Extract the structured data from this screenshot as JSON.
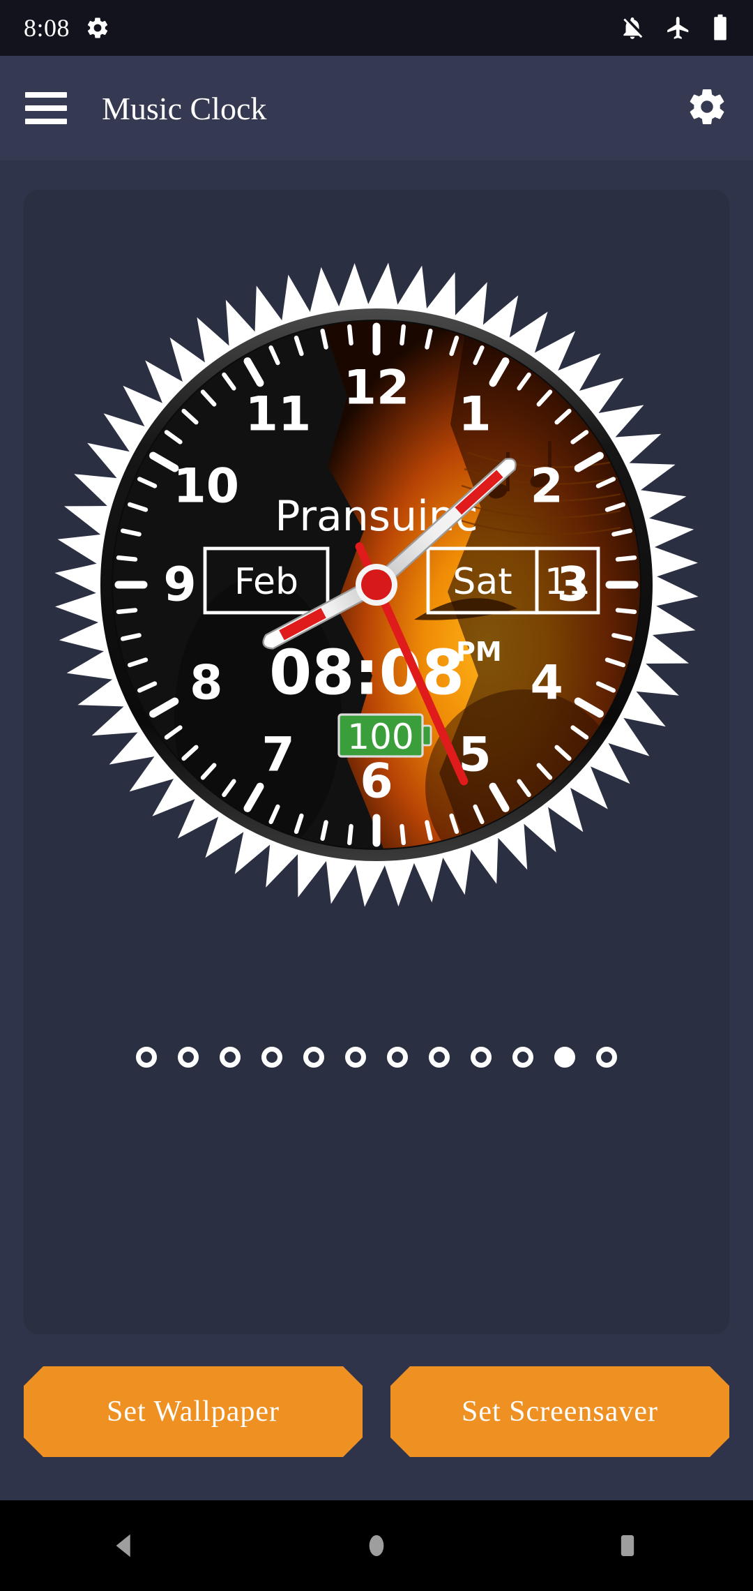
{
  "status_bar": {
    "time": "8:08",
    "icons": [
      "settings-gear-icon",
      "notifications-off-icon",
      "airplane-mode-icon",
      "battery-full-icon"
    ]
  },
  "app_bar": {
    "menu_icon": "hamburger-menu-icon",
    "title": "Music Clock",
    "settings_icon": "gear-icon"
  },
  "clock": {
    "brand": "Pransuinc",
    "month": "Feb",
    "weekday": "Sat",
    "day": "11",
    "digital_time": "08:08",
    "meridiem": "PM",
    "battery": "100",
    "hour_numerals": [
      "1",
      "2",
      "3",
      "4",
      "5",
      "6",
      "7",
      "8",
      "9",
      "10",
      "11",
      "12"
    ],
    "hands": {
      "hour_deg": 242,
      "minute_deg": 48,
      "second_deg": 156
    },
    "colors": {
      "second_hand": "#e01b1b",
      "hand_white": "#f2f2f2",
      "hub": "#d81919",
      "battery_badge": "#3a9e3a",
      "dial_dark": "#121212",
      "dial_flame": "#e08a10"
    }
  },
  "pager": {
    "total": 12,
    "active_index": 10
  },
  "buttons": {
    "set_wallpaper": "Set Wallpaper",
    "set_screensaver": "Set Screensaver",
    "accent_color": "#ef9022"
  },
  "nav_bar": {
    "back": "back-nav-button",
    "home": "home-nav-button",
    "recents": "recents-nav-button"
  }
}
